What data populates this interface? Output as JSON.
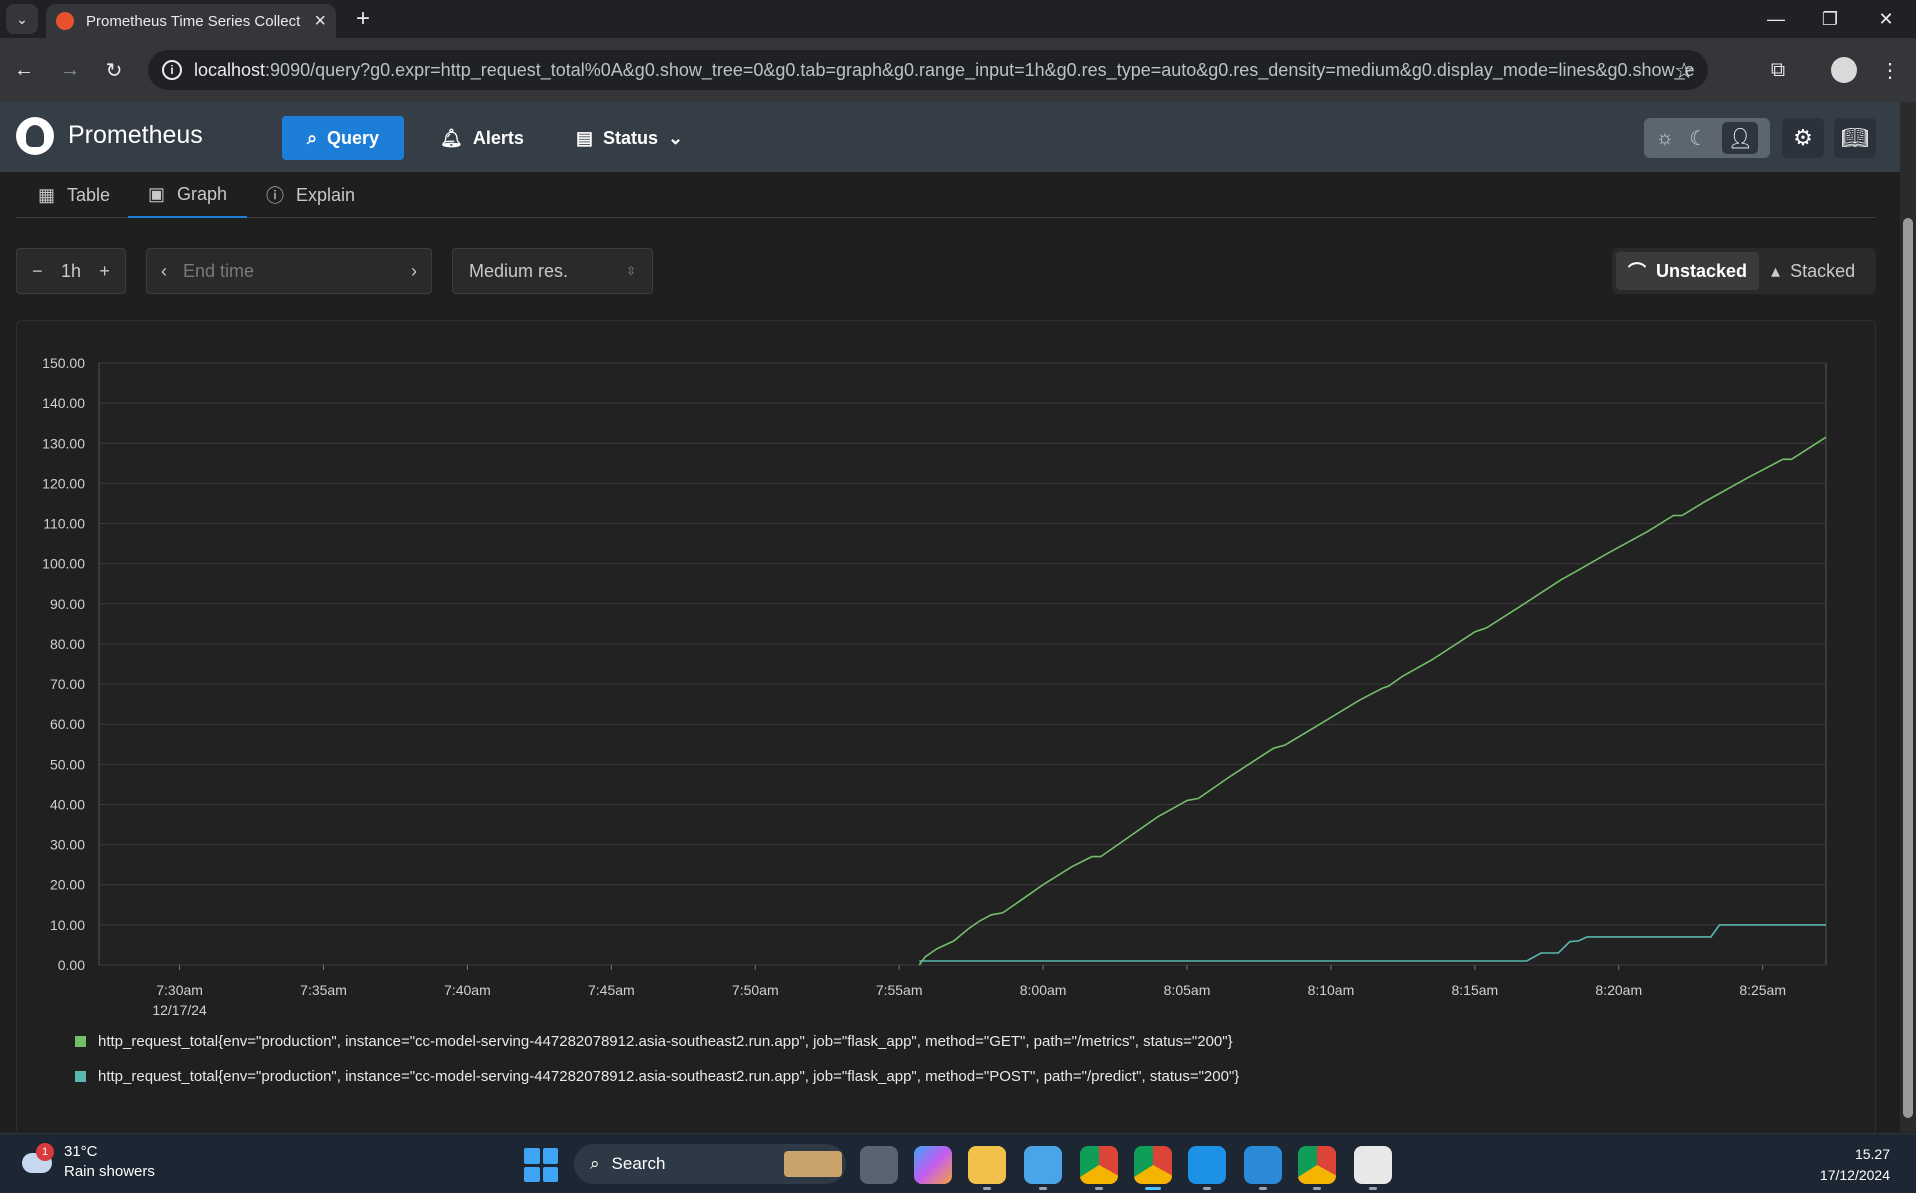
{
  "browser": {
    "tab_title": "Prometheus Time Series Collect",
    "new_tab_symbol": "+",
    "url_host": "localhost",
    "url_rest": ":9090/query?g0.expr=http_request_total%0A&g0.show_tree=0&g0.tab=graph&g0.range_input=1h&g0.res_type=auto&g0.res_density=medium&g0.display_mode=lines&g0.show_exe..."
  },
  "header": {
    "brand": "Prometheus",
    "nav": {
      "query": "Query",
      "alerts": "Alerts",
      "status": "Status"
    }
  },
  "panel": {
    "tabs": {
      "table": "Table",
      "graph": "Graph",
      "explain": "Explain"
    },
    "range": "1h",
    "end_time_placeholder": "End time",
    "resolution": "Medium res.",
    "stack": {
      "unstacked": "Unstacked",
      "stacked": "Stacked"
    }
  },
  "chart_data": {
    "type": "line",
    "ylim": [
      0,
      150
    ],
    "y_ticks": [
      "0.00",
      "10.00",
      "20.00",
      "30.00",
      "40.00",
      "50.00",
      "60.00",
      "70.00",
      "80.00",
      "90.00",
      "100.00",
      "110.00",
      "120.00",
      "130.00",
      "140.00",
      "150.00"
    ],
    "x_ticks": [
      {
        "t": 0,
        "label": "7:30am",
        "sub": "12/17/24"
      },
      {
        "t": 5,
        "label": "7:35am"
      },
      {
        "t": 10,
        "label": "7:40am"
      },
      {
        "t": 15,
        "label": "7:45am"
      },
      {
        "t": 20,
        "label": "7:50am"
      },
      {
        "t": 25,
        "label": "7:55am"
      },
      {
        "t": 30,
        "label": "8:00am"
      },
      {
        "t": 35,
        "label": "8:05am"
      },
      {
        "t": 40,
        "label": "8:10am"
      },
      {
        "t": 45,
        "label": "8:15am"
      },
      {
        "t": 50,
        "label": "8:20am"
      },
      {
        "t": 55,
        "label": "8:25am"
      }
    ],
    "x_range_minutes": [
      -2.8,
      57.2
    ],
    "grid": true,
    "series": [
      {
        "name": "http_request_total{env=\"production\", instance=\"cc-model-serving-447282078912.asia-southeast2.run.app\", job=\"flask_app\", method=\"GET\", path=\"/metrics\", status=\"200\"}",
        "color": "#73bf69",
        "points": [
          [
            25.7,
            0
          ],
          [
            25.9,
            2
          ],
          [
            26.3,
            4
          ],
          [
            26.9,
            6
          ],
          [
            27.4,
            9
          ],
          [
            27.8,
            11
          ],
          [
            28.2,
            12.5
          ],
          [
            28.6,
            13
          ],
          [
            29.2,
            16
          ],
          [
            30,
            20
          ],
          [
            31,
            24.5
          ],
          [
            31.7,
            27
          ],
          [
            32,
            27
          ],
          [
            33,
            32
          ],
          [
            34,
            37
          ],
          [
            35,
            41
          ],
          [
            35.4,
            41.5
          ],
          [
            36.5,
            47
          ],
          [
            38,
            54
          ],
          [
            38.4,
            54.8
          ],
          [
            39.5,
            59.5
          ],
          [
            41,
            66
          ],
          [
            41.8,
            69
          ],
          [
            42,
            69.5
          ],
          [
            42.5,
            72
          ],
          [
            43.5,
            76
          ],
          [
            45,
            83
          ],
          [
            45.4,
            84
          ],
          [
            46.5,
            89
          ],
          [
            48,
            96
          ],
          [
            48.4,
            97.6
          ],
          [
            49.6,
            102.5
          ],
          [
            51,
            108
          ],
          [
            51.9,
            112
          ],
          [
            52.2,
            112
          ],
          [
            53,
            115.5
          ],
          [
            54.5,
            121.5
          ],
          [
            55.7,
            126
          ],
          [
            56,
            126
          ],
          [
            57.2,
            131.5
          ]
        ]
      },
      {
        "name": "http_request_total{env=\"production\", instance=\"cc-model-serving-447282078912.asia-southeast2.run.app\", job=\"flask_app\", method=\"POST\", path=\"/predict\", status=\"200\"}",
        "color": "#5ab8b0",
        "points": [
          [
            25.7,
            1
          ],
          [
            46.8,
            1
          ],
          [
            47.3,
            3
          ],
          [
            47.9,
            3
          ],
          [
            48.3,
            5.8
          ],
          [
            48.6,
            6
          ],
          [
            48.9,
            7
          ],
          [
            53.2,
            7
          ],
          [
            53.5,
            10
          ],
          [
            57.2,
            10
          ]
        ]
      }
    ]
  },
  "taskbar": {
    "weather_temp": "31°C",
    "weather_desc": "Rain showers",
    "weather_badge": "1",
    "search": "Search",
    "time": "15.27",
    "date": "17/12/2024"
  }
}
